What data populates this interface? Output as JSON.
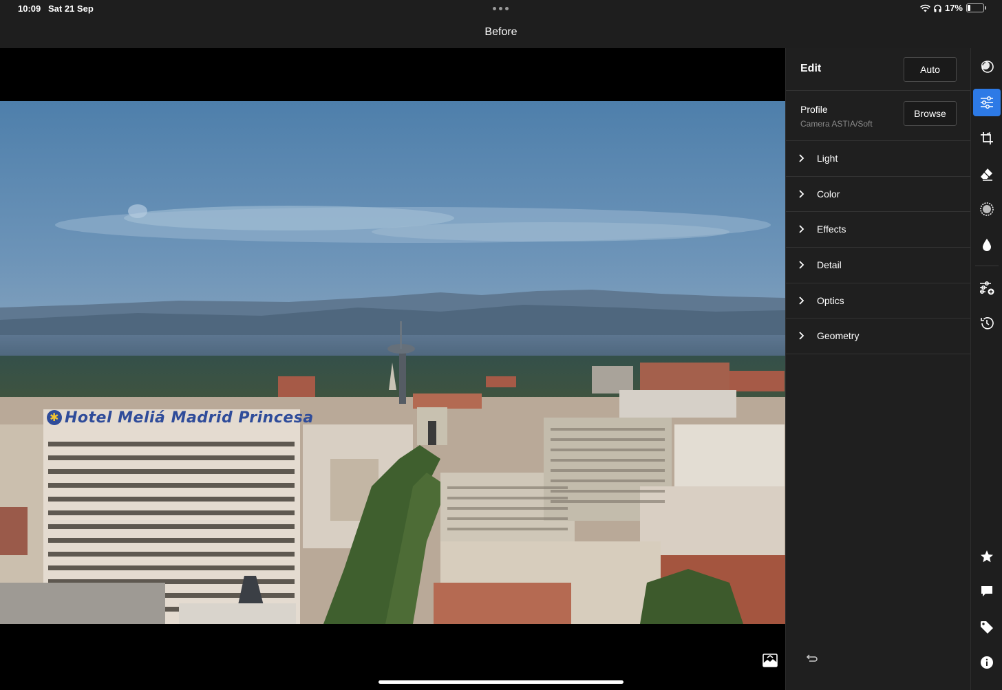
{
  "status_bar": {
    "time": "10:09",
    "date": "Sat 21 Sep",
    "battery_percent": "17%",
    "battery_level": 0.17
  },
  "header": {
    "title": "Before"
  },
  "photo": {
    "sign_text": "Hotel Meliá Madrid Princesa"
  },
  "panel": {
    "title": "Edit",
    "auto_label": "Auto",
    "profile_label": "Profile",
    "profile_value": "Camera ASTIA/Soft",
    "browse_label": "Browse",
    "sections": [
      {
        "label": "Light"
      },
      {
        "label": "Color"
      },
      {
        "label": "Effects"
      },
      {
        "label": "Detail"
      },
      {
        "label": "Optics"
      },
      {
        "label": "Geometry"
      }
    ]
  },
  "toolbar": {
    "tools": [
      {
        "icon": "presets-icon",
        "active": false
      },
      {
        "icon": "edit-sliders-icon",
        "active": true
      },
      {
        "icon": "crop-icon",
        "active": false
      },
      {
        "icon": "healing-eraser-icon",
        "active": false
      },
      {
        "icon": "masking-icon",
        "active": false
      },
      {
        "icon": "blur-drop-icon",
        "active": false
      },
      {
        "icon": "versions-sliders-icon",
        "active": false
      },
      {
        "icon": "history-icon",
        "active": false
      },
      {
        "icon": "rating-star-icon",
        "active": false
      },
      {
        "icon": "comments-icon",
        "active": false
      },
      {
        "icon": "tag-icon",
        "active": false
      },
      {
        "icon": "info-icon",
        "active": false
      }
    ]
  },
  "colors": {
    "accent": "#2d7ae6",
    "panel_bg": "#1f1f1f",
    "sky": "#5b86ae"
  }
}
